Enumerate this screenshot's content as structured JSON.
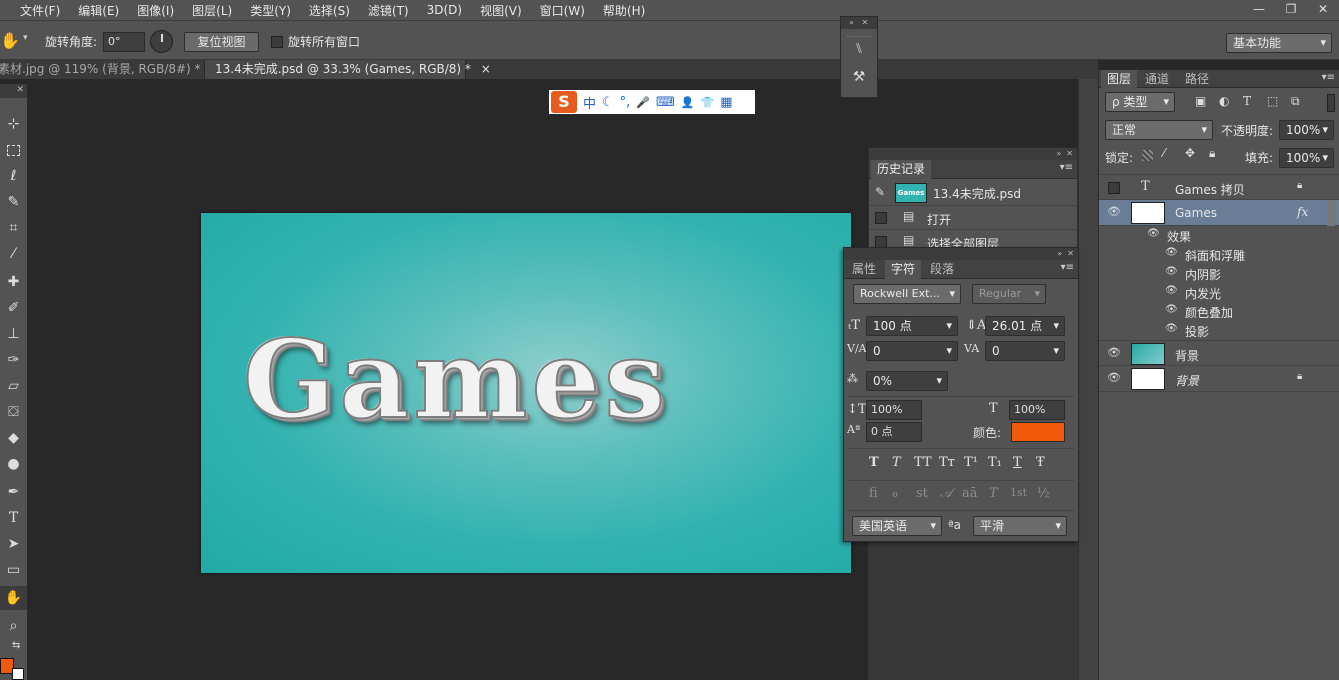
{
  "menubar": {
    "items": [
      "文件(F)",
      "编辑(E)",
      "图像(I)",
      "图层(L)",
      "类型(Y)",
      "选择(S)",
      "滤镜(T)",
      "3D(D)",
      "视图(V)",
      "窗口(W)",
      "帮助(H)"
    ],
    "window_buttons": [
      "—",
      "❐",
      "✕"
    ]
  },
  "options": {
    "rotate_label": "旋转角度:",
    "rotate_value": "0°",
    "reset_view": "复位视图",
    "rotate_all_label": "旋转所有窗口",
    "workspace": "基本功能"
  },
  "doc_tabs": [
    {
      "label": "素材.jpg @ 119% (背景, RGB/8#) *",
      "close": "×"
    },
    {
      "label": "13.4未完成.psd @ 33.3% (Games, RGB/8) *",
      "close": "×"
    }
  ],
  "canvas": {
    "text": "Games"
  },
  "ime": {
    "logo": "S",
    "mode": "中",
    "moon": "☾",
    "punct": "°,",
    "mic": "🎤",
    "kbd": "⌨",
    "user": "👤",
    "shirt": "👕",
    "grid": "▦"
  },
  "history": {
    "tab": "历史记录",
    "snapshot": "13.4未完成.psd",
    "snapshot_thumb_text": "Games",
    "items": [
      "打开",
      "选择全部图层"
    ]
  },
  "character": {
    "tabs": [
      "属性",
      "字符",
      "段落"
    ],
    "font_family": "Rockwell Ext...",
    "font_style": "Regular",
    "size": "100 点",
    "leading": "26.01 点",
    "kerning": "0",
    "tracking": "0",
    "scale_pct": "0%",
    "vscale": "100%",
    "hscale": "100%",
    "baseline": "0 点",
    "color_label": "颜色:",
    "color": "#f05a0a",
    "style_buttons": [
      "T",
      "T",
      "TT",
      "Tт",
      "T¹",
      "T₁",
      "T",
      "Ŧ"
    ],
    "opentype_buttons": [
      "fi",
      "ℴ",
      "st",
      "𝒜",
      "aā",
      "T",
      "1st",
      "½"
    ],
    "language": "美国英语",
    "aa_label": "ªa",
    "antialias": "平滑"
  },
  "layers": {
    "tabs": [
      "图层",
      "通道",
      "路径"
    ],
    "filter_kind": "ρ 类型",
    "blend_mode": "正常",
    "opacity_label": "不透明度:",
    "opacity": "100%",
    "lock_label": "锁定:",
    "fill_label": "填充:",
    "fill": "100%",
    "rows": [
      {
        "name": "Games 拷贝"
      },
      {
        "name": "Games",
        "fx": "fx"
      },
      {
        "name": "背景"
      },
      {
        "name": "背景"
      }
    ],
    "effects_label": "效果",
    "effects": [
      "斜面和浮雕",
      "内阴影",
      "内发光",
      "颜色叠加",
      "投影"
    ]
  },
  "colors": {
    "accent_orange": "#f05a0a",
    "teal": "#33b3b0",
    "selected_row": "#6a7d97"
  }
}
